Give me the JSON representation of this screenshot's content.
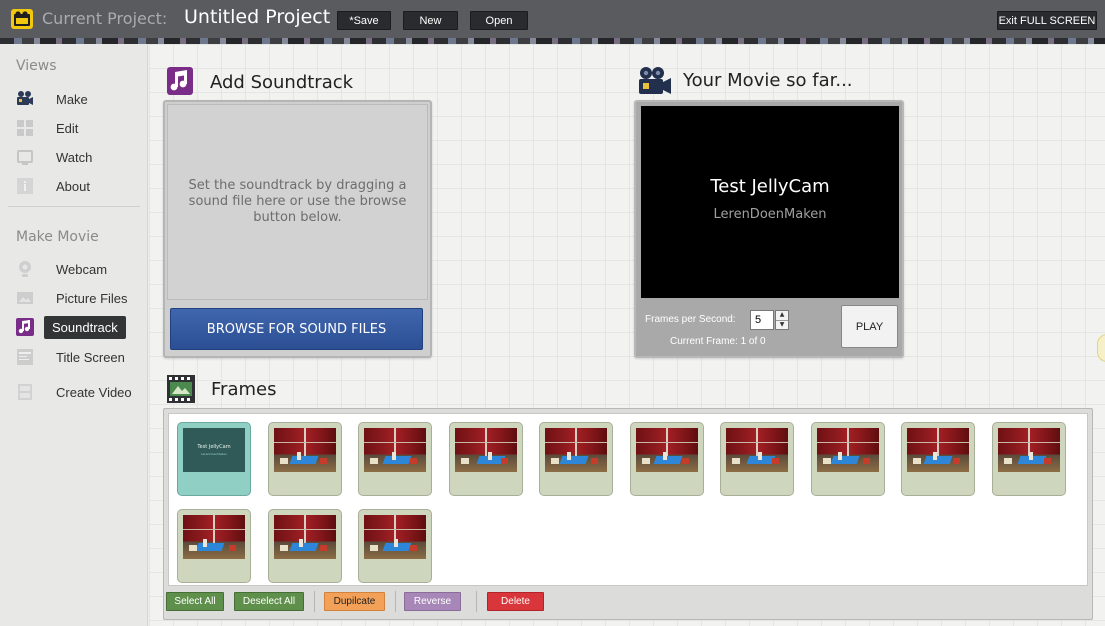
{
  "header": {
    "project_label": "Current Project:",
    "project_name": "Untitled Project",
    "save_label": "*Save",
    "new_label": "New",
    "open_label": "Open",
    "exit_label": "Exit FULL SCREEN",
    "logo_icon": "jellycam-logo-icon"
  },
  "sidebar": {
    "views_heading": "Views",
    "views": [
      {
        "label": "Make",
        "icon": "camera-icon"
      },
      {
        "label": "Edit",
        "icon": "grid-icon"
      },
      {
        "label": "Watch",
        "icon": "screen-icon"
      },
      {
        "label": "About",
        "icon": "info-icon"
      }
    ],
    "make_heading": "Make Movie",
    "make": [
      {
        "label": "Webcam",
        "icon": "webcam-icon"
      },
      {
        "label": "Picture Files",
        "icon": "picture-icon"
      },
      {
        "label": "Soundtrack",
        "icon": "music-note-icon",
        "active": true
      },
      {
        "label": "Title Screen",
        "icon": "title-icon"
      },
      {
        "label": "Create Video",
        "icon": "film-icon"
      }
    ]
  },
  "soundtrack": {
    "title": "Add Soundtrack",
    "instructions": "Set the soundtrack by dragging a sound file here or use the browse button below.",
    "browse_label": "BROWSE FOR SOUND FILES"
  },
  "movie": {
    "title": "Your Movie so far...",
    "screen_title": "Test JellyCam",
    "screen_subtitle": "LerenDoenMaken",
    "fps_label": "Frames per Second:",
    "fps_value": "5",
    "current_frame_label": "Current Frame:  1 of 0",
    "play_label": "PLAY"
  },
  "frames": {
    "title": "Frames",
    "items": [
      {
        "type": "title",
        "t1": "Test JellyCam",
        "t2": "LerenDoenMaken",
        "selected": true
      },
      {
        "type": "photo"
      },
      {
        "type": "photo"
      },
      {
        "type": "photo"
      },
      {
        "type": "photo"
      },
      {
        "type": "photo"
      },
      {
        "type": "photo"
      },
      {
        "type": "photo"
      },
      {
        "type": "photo"
      },
      {
        "type": "photo"
      },
      {
        "type": "photo"
      },
      {
        "type": "photo"
      },
      {
        "type": "photo"
      }
    ],
    "buttons": {
      "select_all": "Select All",
      "deselect_all": "Deselect All",
      "duplicate": "Dupilcate",
      "reverse": "Reverse",
      "delete": "Delete"
    }
  },
  "colors": {
    "topbar": "#5a5b5f",
    "browse_button": "#2c4f94",
    "selected_frame": "#8fcfc4",
    "frame_bg": "#cfd6be",
    "select_green": "#5e8f4b",
    "duplicate_orange": "#f3a158",
    "reverse_purple": "#a787b7",
    "delete_red": "#d8363a"
  }
}
